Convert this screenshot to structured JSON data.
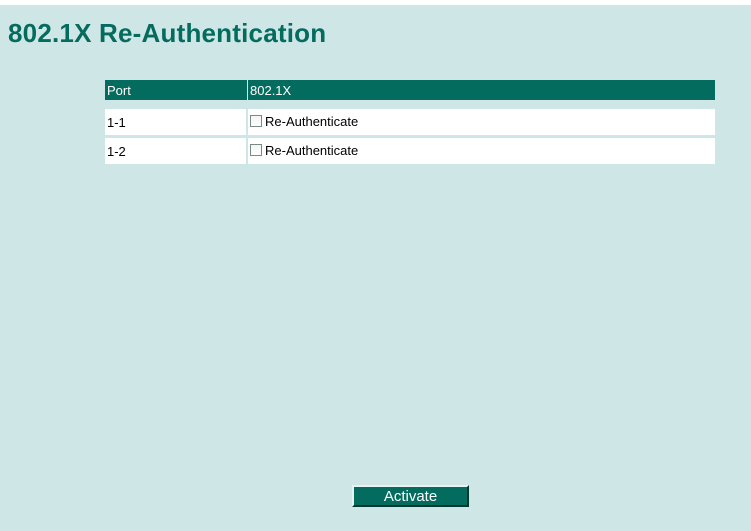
{
  "page": {
    "title": "802.1X Re-Authentication"
  },
  "table": {
    "headers": [
      "Port",
      "802.1X"
    ],
    "rows": [
      {
        "port": "1-1",
        "action_label": "Re-Authenticate",
        "checked": false
      },
      {
        "port": "1-2",
        "action_label": "Re-Authenticate",
        "checked": false
      }
    ]
  },
  "actions": {
    "activate_label": "Activate"
  },
  "colors": {
    "background": "#cfe6e6",
    "accent": "#046c5e",
    "cell": "#ffffff"
  }
}
